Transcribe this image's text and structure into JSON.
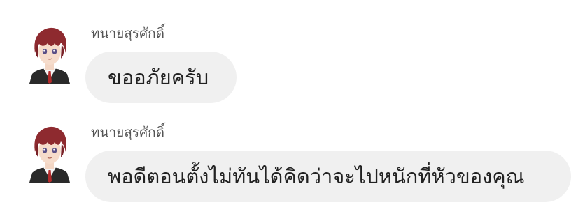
{
  "conversation": {
    "messages": [
      {
        "sender": "ทนายสุรศักดิ์",
        "text": "ขออภัยครับ",
        "avatar_icon": "anime-boy-red-hair-avatar"
      },
      {
        "sender": "ทนายสุรศักดิ์",
        "text": "พอดีตอนตั้งไม่ทันได้คิดว่าจะไปหนักที่หัวของคุณ",
        "avatar_icon": "anime-boy-red-hair-avatar"
      }
    ]
  },
  "colors": {
    "background": "#ffffff",
    "bubble": "#f0f0f0",
    "sender_text": "#555555",
    "message_text": "#222222",
    "avatar_hair": "#8e2a2f",
    "avatar_tie": "#b32b2b"
  }
}
